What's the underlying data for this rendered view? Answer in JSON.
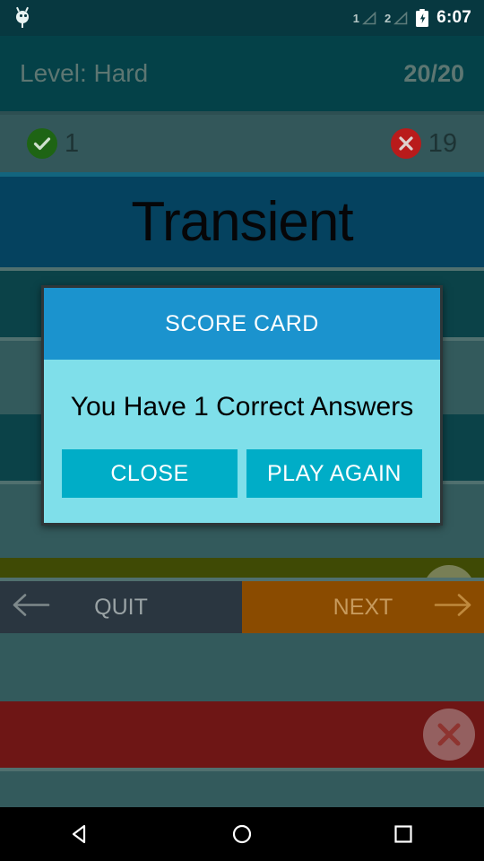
{
  "status_bar": {
    "notification_icon": "android-robot-icon",
    "sim1_label": "1",
    "sim2_label": "2",
    "battery_icon": "battery-charging-icon",
    "time": "6:07"
  },
  "header": {
    "level_label": "Level: Hard",
    "progress": "20/20"
  },
  "score_strip": {
    "correct_icon": "check-circle-icon",
    "correct_count": "1",
    "wrong_icon": "x-circle-icon",
    "wrong_count": "19"
  },
  "quiz": {
    "question": "Transient",
    "answers": [
      {
        "text": "",
        "state": "neutral",
        "mark": ""
      },
      {
        "text": "",
        "state": "neutral",
        "mark": ""
      },
      {
        "text": "",
        "state": "correct",
        "mark": "check-icon"
      },
      {
        "text": "",
        "state": "wrong",
        "mark": "x-icon"
      }
    ]
  },
  "action_bar": {
    "quit_label": "QUIT",
    "quit_icon": "arrow-left-icon",
    "next_label": "NEXT",
    "next_icon": "arrow-right-icon"
  },
  "dialog": {
    "title": "SCORE CARD",
    "message": "You Have 1 Correct Answers",
    "close_label": "CLOSE",
    "play_again_label": "PLAY AGAIN"
  },
  "nav_bar": {
    "back_icon": "triangle-back-icon",
    "home_icon": "circle-home-icon",
    "recents_icon": "square-recents-icon"
  },
  "colors": {
    "status_bar_bg": "#073840",
    "header_bg": "#044148",
    "score_strip_bg": "#33575a",
    "question_bg": "#05425f",
    "answer_neutral": "#0b4248",
    "answer_correct": "#3f4a05",
    "answer_wrong": "#6e1615",
    "quit_bg": "#2a3640",
    "next_bg": "#8a4b00",
    "dialog_header": "#1b93ce",
    "dialog_body": "#7fdfea",
    "dialog_button": "#00adc7",
    "page_bg": "#335a5c"
  }
}
